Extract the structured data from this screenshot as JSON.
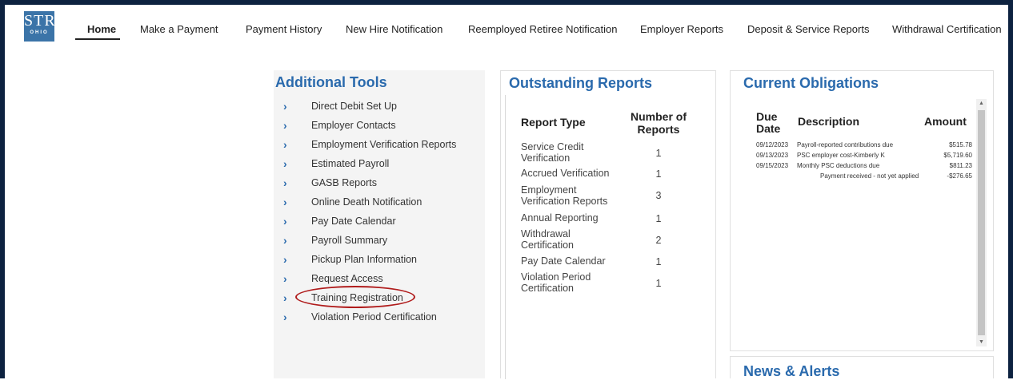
{
  "logo": {
    "top": "STRS",
    "bottom": "OHIO"
  },
  "nav": {
    "items": [
      "Home",
      "Make a Payment",
      "Payment History",
      "New Hire Notification",
      "Reemployed Retiree Notification",
      "Employer Reports",
      "Deposit & Service Reports",
      "Withdrawal Certification"
    ],
    "active": "Home"
  },
  "tools": {
    "title": "Additional Tools",
    "items": [
      "Direct Debit Set Up",
      "Employer Contacts",
      "Employment Verification Reports",
      "Estimated Payroll",
      "GASB Reports",
      "Online Death Notification",
      "Pay Date Calendar",
      "Payroll Summary",
      "Pickup Plan Information",
      "Request Access",
      "Training Registration",
      "Violation Period Certification"
    ],
    "highlighted": "Training Registration"
  },
  "reports": {
    "title": "Outstanding Reports",
    "col_type": "Report Type",
    "col_number": "Number of Reports",
    "rows": [
      {
        "type": "Service Credit Verification",
        "count": "1"
      },
      {
        "type": "Accrued Verification",
        "count": "1"
      },
      {
        "type": "Employment Verification Reports",
        "count": "3"
      },
      {
        "type": "Annual Reporting",
        "count": "1"
      },
      {
        "type": "Withdrawal Certification",
        "count": "2"
      },
      {
        "type": "Pay Date Calendar",
        "count": "1"
      },
      {
        "type": "Violation Period Certification",
        "count": "1"
      }
    ]
  },
  "obligations": {
    "title": "Current Obligations",
    "col_due": "Due Date",
    "col_desc": "Description",
    "col_amount": "Amount",
    "rows": [
      {
        "date": "09/12/2023",
        "desc": "Payroll-reported contributions due",
        "amount": "$515.78"
      },
      {
        "date": "09/13/2023",
        "desc": "PSC employer cost-Kimberly K",
        "amount": "$5,719.60"
      },
      {
        "date": "09/15/2023",
        "desc": "Monthly PSC deductions due",
        "amount": "$811.23"
      },
      {
        "date": "",
        "desc": "Payment received - not yet applied",
        "amount": "-$276.65"
      }
    ]
  },
  "news": {
    "title": "News & Alerts"
  },
  "colors": {
    "accent": "#2a6aad",
    "frame": "#0d2240",
    "highlight_circle": "#b01c1c",
    "logo_bg": "#3b74a8"
  }
}
